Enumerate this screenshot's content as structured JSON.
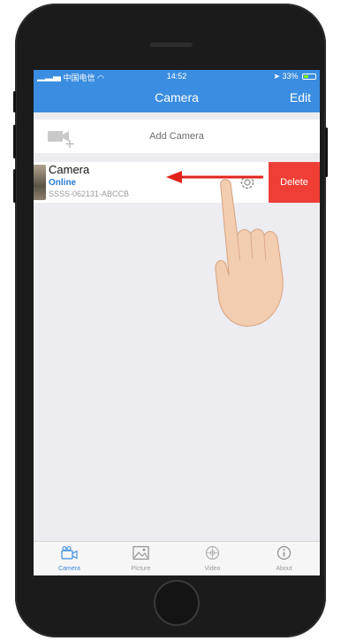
{
  "status_bar": {
    "carrier": "中国电信",
    "time": "14:52",
    "battery": "33%"
  },
  "nav": {
    "title": "Camera",
    "edit_label": "Edit"
  },
  "add_camera": {
    "label": "Add Camera"
  },
  "camera_item": {
    "name": "Camera",
    "status": "Online",
    "id": "SSSS-062131-ABCCB",
    "delete_label": "Delete"
  },
  "tabs": [
    {
      "label": "Camera",
      "icon": "camera-tab-icon",
      "active": true
    },
    {
      "label": "Picture",
      "icon": "picture-icon",
      "active": false
    },
    {
      "label": "Video",
      "icon": "video-icon",
      "active": false
    },
    {
      "label": "About",
      "icon": "info-icon",
      "active": false
    }
  ],
  "colors": {
    "accent": "#3a8de0",
    "delete": "#ef3e36",
    "online": "#2a7bd6"
  }
}
